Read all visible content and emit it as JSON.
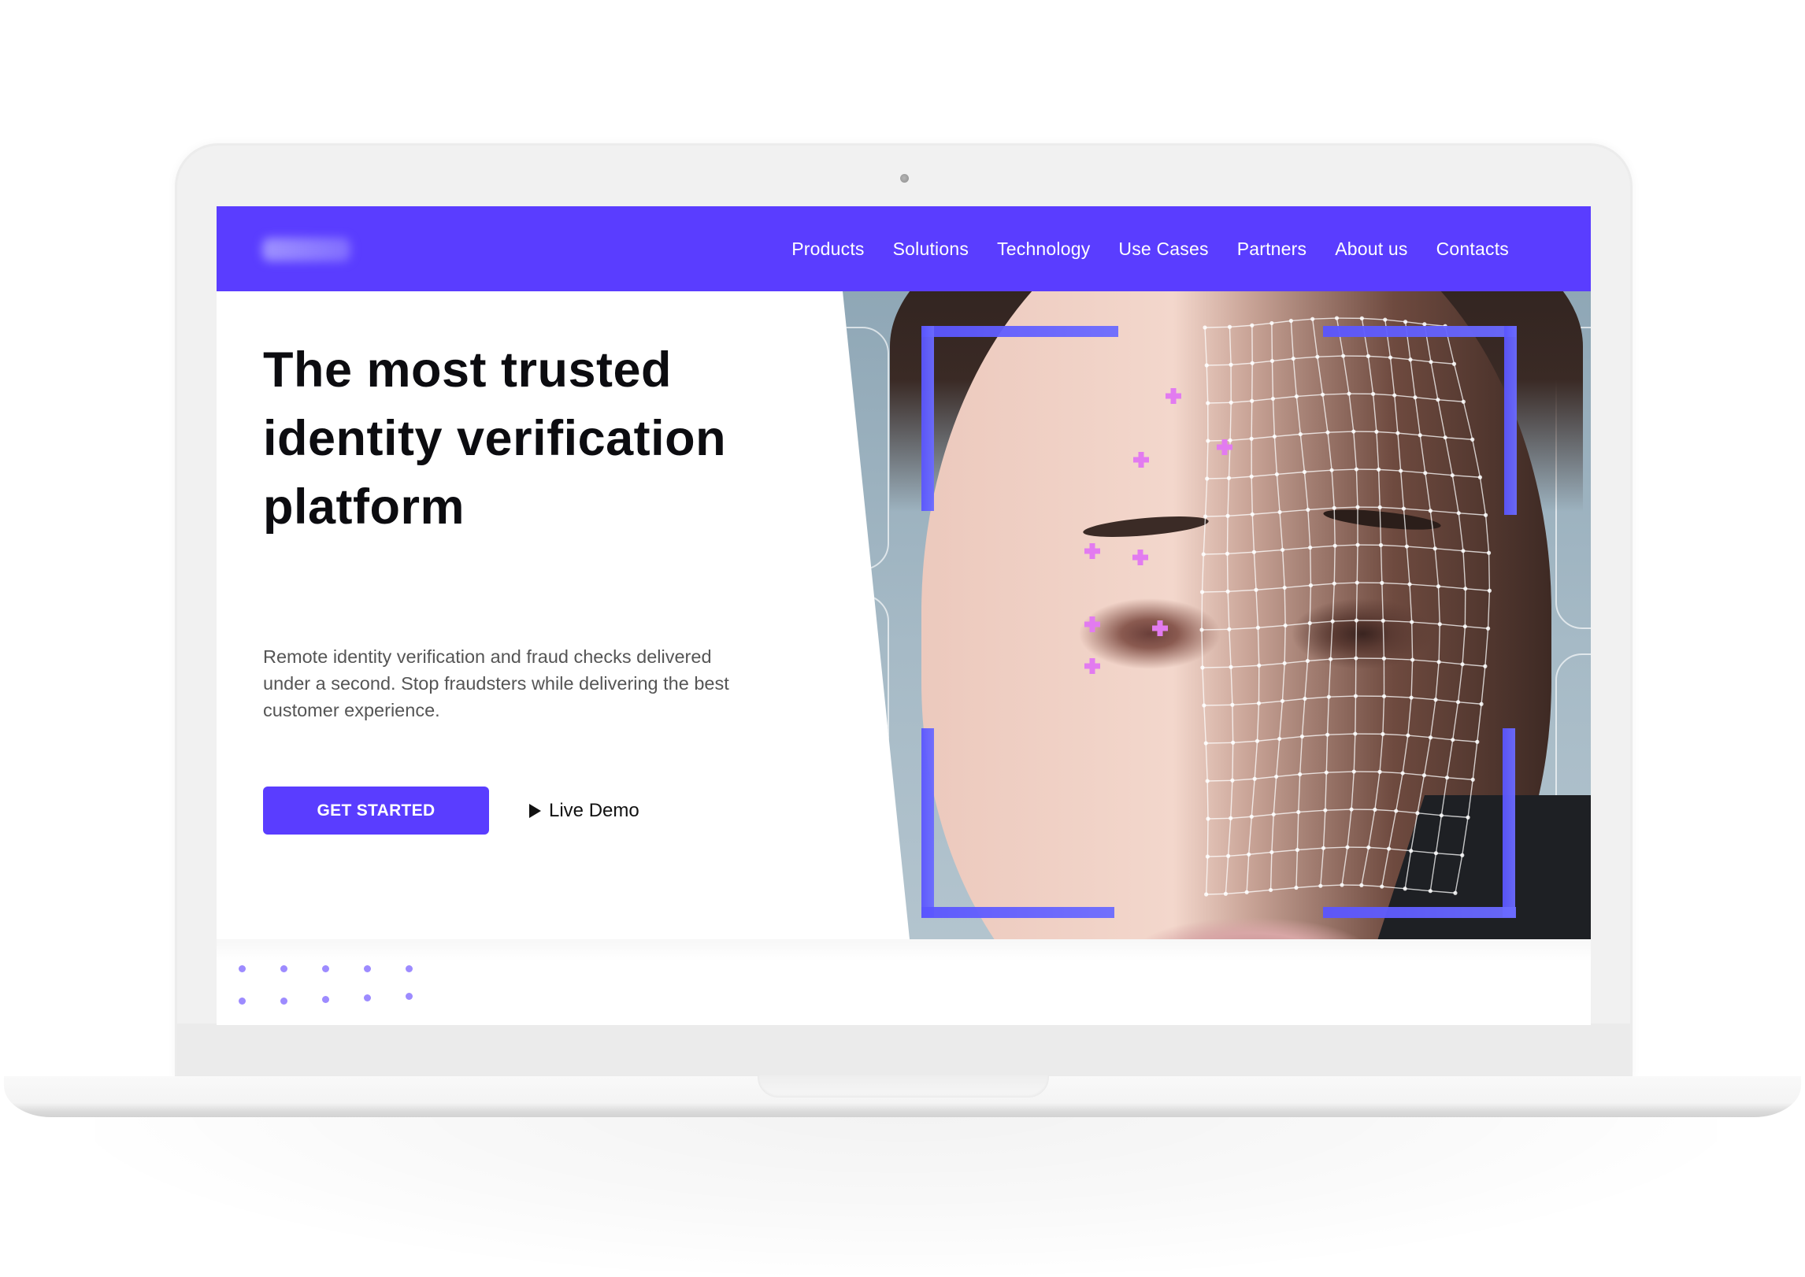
{
  "brand": {
    "logo_text": "",
    "accent_color": "#5a3dff",
    "dot_color": "#9d8bff"
  },
  "nav": {
    "items": [
      {
        "label": "Products"
      },
      {
        "label": "Solutions"
      },
      {
        "label": "Technology"
      },
      {
        "label": "Use Cases"
      },
      {
        "label": "Partners"
      },
      {
        "label": "About us"
      },
      {
        "label": "Contacts"
      }
    ]
  },
  "hero": {
    "title_lines": [
      "The most trusted",
      "identity verification",
      "platform"
    ],
    "subtitle_lines": [
      "Remote identity verification and fraud checks delivered",
      "under a second. Stop fraudsters while delivering the best",
      "customer experience."
    ],
    "cta_primary": "GET STARTED",
    "cta_secondary": "Live Demo",
    "image_alt": "Face with biometric mesh overlay and scan frame"
  },
  "icons": {
    "play": "play-icon",
    "camera": "webcam-icon"
  }
}
